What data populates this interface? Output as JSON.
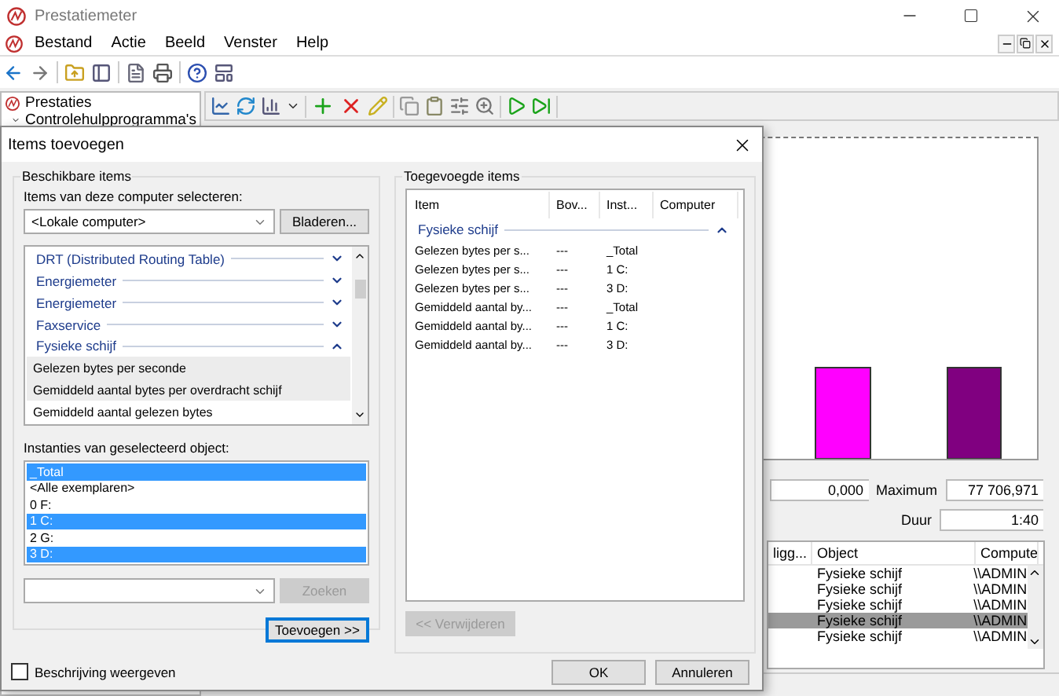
{
  "window": {
    "title": "Prestatiemeter"
  },
  "menu": [
    "Bestand",
    "Actie",
    "Beeld",
    "Venster",
    "Help"
  ],
  "tree": [
    {
      "label": "Prestaties",
      "children": [
        {
          "label": "Controlehulpprogramma's",
          "expanded": true
        }
      ]
    }
  ],
  "stats": {
    "value": "0,000",
    "maximum_label": "Maximum",
    "maximum": "77 706,971",
    "duration_label": "Duur",
    "duration": "1:40"
  },
  "counters": {
    "columns": [
      "ligg...",
      "Object",
      "Compute"
    ],
    "rows": [
      {
        "object": "Fysieke schijf",
        "computer": "\\\\ADMIN",
        "selected": false
      },
      {
        "object": "Fysieke schijf",
        "computer": "\\\\ADMIN",
        "selected": false
      },
      {
        "object": "Fysieke schijf",
        "computer": "\\\\ADMIN",
        "selected": false
      },
      {
        "object": "Fysieke schijf",
        "computer": "\\\\ADMIN",
        "selected": true
      },
      {
        "object": "Fysieke schijf",
        "computer": "\\\\ADMIN",
        "selected": false
      }
    ]
  },
  "dialog": {
    "title": "Items toevoegen",
    "available": {
      "title": "Beschikbare items",
      "computer_label": "Items van deze computer selecteren:",
      "computer": "<Lokale computer>",
      "browse": "Bladeren...",
      "items": [
        {
          "kind": "category",
          "label": "DRT (Distributed Routing Table)",
          "expanded": false
        },
        {
          "kind": "category",
          "label": "Energiemeter",
          "expanded": false
        },
        {
          "kind": "category",
          "label": "Energiemeter",
          "expanded": false
        },
        {
          "kind": "category",
          "label": "Faxservice",
          "expanded": false
        },
        {
          "kind": "category",
          "label": "Fysieke schijf",
          "expanded": true
        },
        {
          "kind": "counter",
          "label": "Gelezen bytes per seconde",
          "selected": true
        },
        {
          "kind": "counter",
          "label": "Gemiddeld aantal bytes per overdracht schijf",
          "selected": true
        },
        {
          "kind": "counter",
          "label": "Gemiddeld aantal gelezen bytes",
          "selected": false
        }
      ],
      "instances_label": "Instanties van geselecteerd object:",
      "instances": [
        {
          "label": "_Total",
          "selected": true
        },
        {
          "label": "<Alle exemplaren>",
          "selected": false
        },
        {
          "label": "0 F:",
          "selected": false
        },
        {
          "label": "1 C:",
          "selected": true
        },
        {
          "label": "2 G:",
          "selected": false
        },
        {
          "label": "3 D:",
          "selected": true
        }
      ],
      "search_button": {
        "label": "Zoeken",
        "disabled": true
      },
      "add_button": {
        "label": "Toevoegen >>",
        "focused": true
      }
    },
    "added": {
      "title": "Toegevoegde items",
      "columns": [
        "Item",
        "Bov...",
        "Inst...",
        "Computer"
      ],
      "group": {
        "label": "Fysieke schijf",
        "expanded": true
      },
      "rows": [
        {
          "item": "Gelezen bytes per s...",
          "parent": "---",
          "instance": "_Total"
        },
        {
          "item": "Gelezen bytes per s...",
          "parent": "---",
          "instance": "1 C:"
        },
        {
          "item": "Gelezen bytes per s...",
          "parent": "---",
          "instance": "3 D:"
        },
        {
          "item": "Gemiddeld aantal by...",
          "parent": "---",
          "instance": "_Total"
        },
        {
          "item": "Gemiddeld aantal by...",
          "parent": "---",
          "instance": "1 C:"
        },
        {
          "item": "Gemiddeld aantal by...",
          "parent": "---",
          "instance": "3 D:"
        }
      ],
      "remove_button": {
        "label": "<< Verwijderen",
        "disabled": true
      }
    },
    "description": {
      "label": "Beschrijving weergeven",
      "checked": false
    },
    "buttons": [
      "OK",
      "Annuleren"
    ]
  }
}
